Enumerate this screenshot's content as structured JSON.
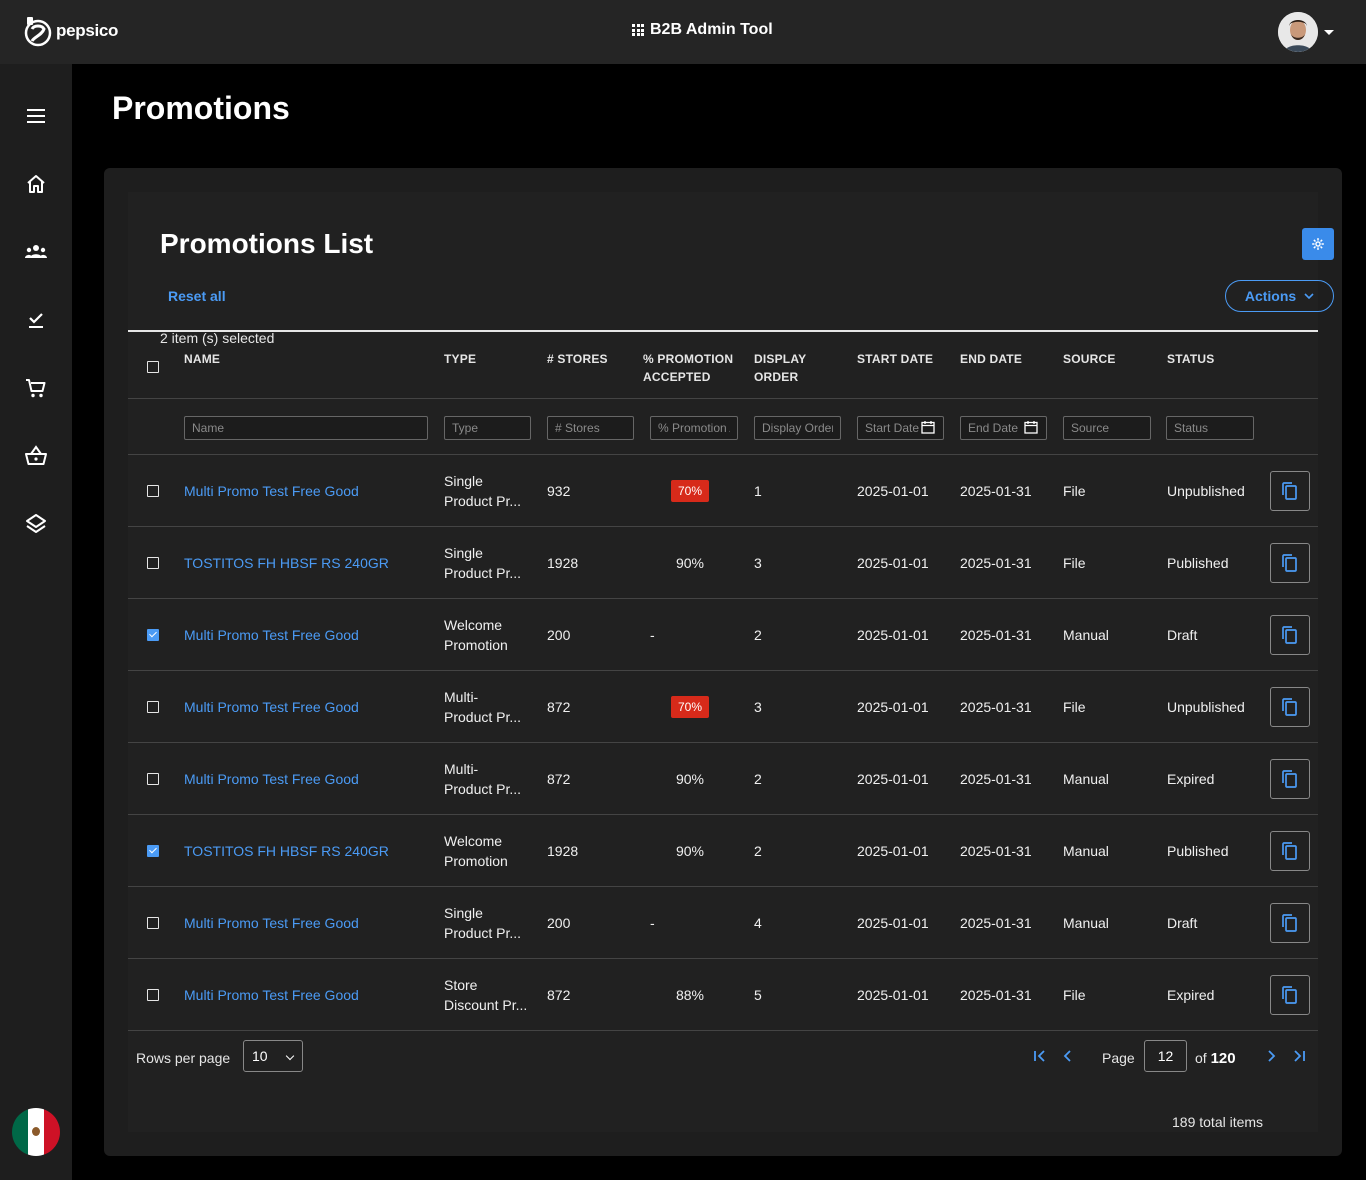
{
  "header": {
    "logo_text": "pepsico",
    "app_title": "B2B Admin Tool"
  },
  "page": {
    "title": "Promotions"
  },
  "list": {
    "title": "Promotions List",
    "reset_label": "Reset all",
    "actions_label": "Actions",
    "selected_text": "2 item (s) selected"
  },
  "columns": {
    "name": "NAME",
    "type": "TYPE",
    "stores": "# STORES",
    "promo_line1": "% PROMOTION",
    "promo_line2": "ACCEPTED",
    "order_line1": "DISPLAY",
    "order_line2": "ORDER",
    "start": "START DATE",
    "end": "END DATE",
    "source": "SOURCE",
    "status": "STATUS"
  },
  "filters": {
    "name": "Name",
    "type": "Type",
    "stores": "# Stores",
    "promo": "% Promotion Accepted",
    "order": "Display Order",
    "start": "Start Date",
    "end": "End Date",
    "source": "Source",
    "status": "Status"
  },
  "rows": [
    {
      "checked": false,
      "name": "Multi Promo Test Free Good",
      "type1": "Single",
      "type2": "Product Pr...",
      "stores": "932",
      "promo": "70%",
      "promo_alert": true,
      "order": "1",
      "start": "2025-01-01",
      "end": "2025-01-31",
      "source": "File",
      "status": "Unpublished"
    },
    {
      "checked": false,
      "name": "TOSTITOS FH HBSF RS 240GR",
      "type1": "Single",
      "type2": "Product Pr...",
      "stores": "1928",
      "promo": "90%",
      "promo_alert": false,
      "order": "3",
      "start": "2025-01-01",
      "end": "2025-01-31",
      "source": "File",
      "status": "Published"
    },
    {
      "checked": true,
      "name": "Multi Promo Test Free Good",
      "type1": "Welcome",
      "type2": "Promotion",
      "stores": "200",
      "promo": "-",
      "promo_alert": false,
      "order": "2",
      "start": "2025-01-01",
      "end": "2025-01-31",
      "source": "Manual",
      "status": "Draft"
    },
    {
      "checked": false,
      "name": "Multi Promo Test Free Good",
      "type1": "Multi-",
      "type2": "Product Pr...",
      "stores": "872",
      "promo": "70%",
      "promo_alert": true,
      "order": "3",
      "start": "2025-01-01",
      "end": "2025-01-31",
      "source": "File",
      "status": "Unpublished"
    },
    {
      "checked": false,
      "name": "Multi Promo Test Free Good",
      "type1": "Multi-",
      "type2": "Product Pr...",
      "stores": "872",
      "promo": "90%",
      "promo_alert": false,
      "order": "2",
      "start": "2025-01-01",
      "end": "2025-01-31",
      "source": "Manual",
      "status": "Expired"
    },
    {
      "checked": true,
      "name": "TOSTITOS FH HBSF RS 240GR",
      "type1": "Welcome",
      "type2": "Promotion",
      "stores": "1928",
      "promo": "90%",
      "promo_alert": false,
      "order": "2",
      "start": "2025-01-01",
      "end": "2025-01-31",
      "source": "Manual",
      "status": "Published"
    },
    {
      "checked": false,
      "name": "Multi Promo Test Free Good",
      "type1": "Single",
      "type2": "Product Pr...",
      "stores": "200",
      "promo": "-",
      "promo_alert": false,
      "order": "4",
      "start": "2025-01-01",
      "end": "2025-01-31",
      "source": "Manual",
      "status": "Draft"
    },
    {
      "checked": false,
      "name": "Multi Promo Test Free Good",
      "type1": "Store",
      "type2": "Discount Pr...",
      "stores": "872",
      "promo": "88%",
      "promo_alert": false,
      "order": "5",
      "start": "2025-01-01",
      "end": "2025-01-31",
      "source": "File",
      "status": "Expired"
    }
  ],
  "pagination": {
    "rows_per_page_label": "Rows per page",
    "rows_per_page": "10",
    "page_label": "Page",
    "current_page": "12",
    "of_label": "of",
    "total_pages": "120",
    "total_items": "189 total items"
  },
  "icons": {
    "sidebar": [
      "menu-icon",
      "home-icon",
      "users-icon",
      "checklist-icon",
      "cart-icon",
      "basket-icon",
      "layers-icon"
    ],
    "row_action": "copy-icon"
  },
  "colors": {
    "accent": "#4b9bf5",
    "alert": "#d72a1a",
    "gear_button": "#3a8bea"
  }
}
